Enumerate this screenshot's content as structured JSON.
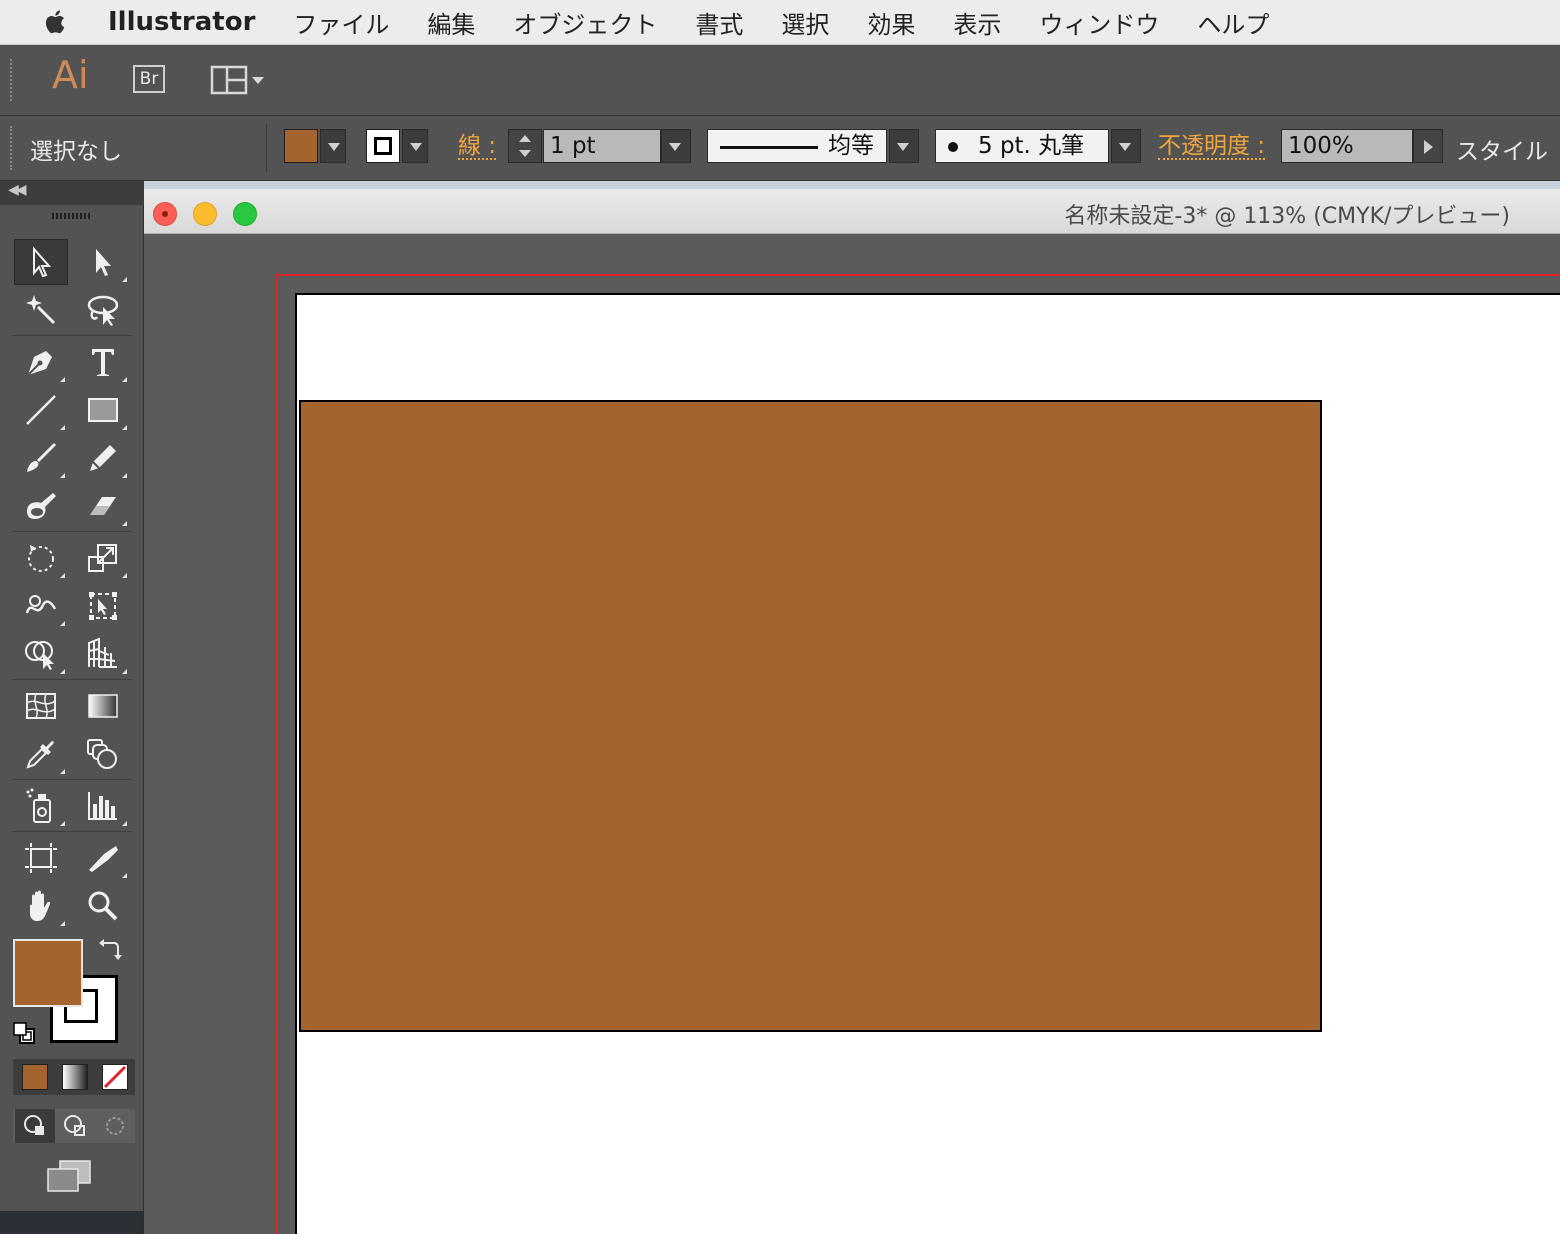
{
  "menubar": {
    "app_name": "Illustrator",
    "items": [
      "ファイル",
      "編集",
      "オブジェクト",
      "書式",
      "選択",
      "効果",
      "表示",
      "ウィンドウ",
      "ヘルプ"
    ]
  },
  "appbar": {
    "logo": "Ai",
    "bridge_label": "Br"
  },
  "controlbar": {
    "selection_status": "選択なし",
    "fill_color": "#a5632e",
    "stroke_label": "線 :",
    "stroke_weight": "1 pt",
    "variable_width_label": "均等",
    "brush_label": "5 pt. 丸筆",
    "opacity_label": "不透明度 :",
    "opacity_value": "100%",
    "style_label": "スタイル"
  },
  "document": {
    "title": "名称未設定-3* @ 113% (CMYK/プレビュー)",
    "rectangle_fill": "#a5632e",
    "bleed_color": "#e0242a"
  },
  "tools_panel": {
    "fill_color": "#a5632e",
    "stroke_color": "#000000",
    "tools": [
      "selection-tool",
      "direct-selection-tool",
      "magic-wand-tool",
      "lasso-tool",
      "pen-tool",
      "type-tool",
      "line-segment-tool",
      "rectangle-tool",
      "paintbrush-tool",
      "pencil-tool",
      "blob-brush-tool",
      "eraser-tool",
      "rotate-tool",
      "scale-tool",
      "warp-tool",
      "free-transform-tool",
      "shape-builder-tool",
      "perspective-grid-tool",
      "mesh-tool",
      "gradient-tool",
      "eyedropper-tool",
      "blend-tool",
      "symbol-sprayer-tool",
      "column-graph-tool",
      "artboard-tool",
      "slice-tool",
      "hand-tool",
      "zoom-tool"
    ]
  }
}
